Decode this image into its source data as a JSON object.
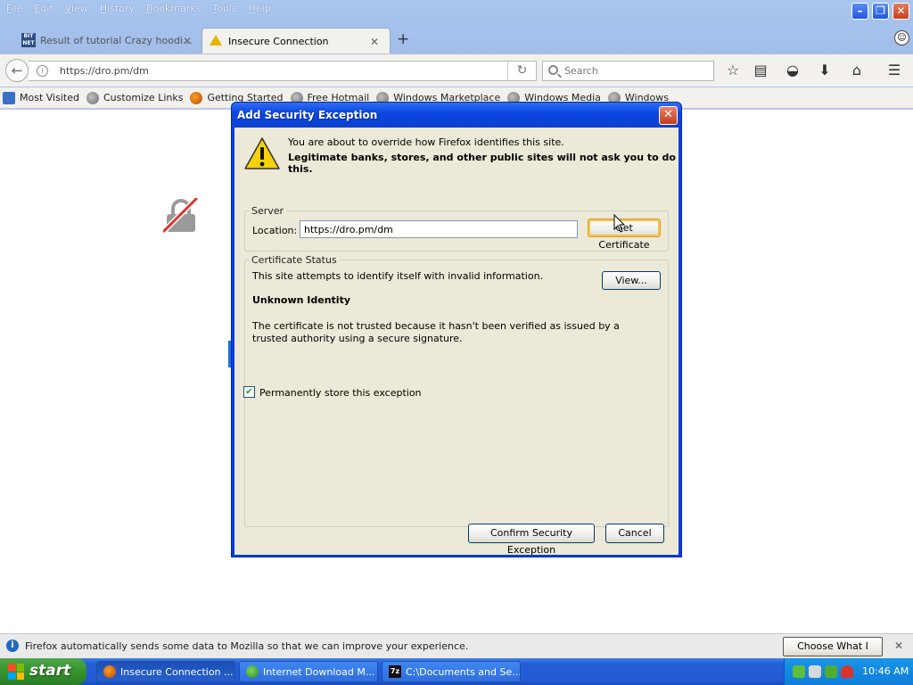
{
  "menubar": [
    "File",
    "Edit",
    "View",
    "History",
    "Bookmarks",
    "Tools",
    "Help"
  ],
  "tabs": [
    {
      "label": "Result of tutorial Crazy hoodi...",
      "favicon": "BIT NET"
    },
    {
      "label": "Insecure Connection",
      "active": true
    }
  ],
  "navbar": {
    "url": "https://dro.pm/dm",
    "search_placeholder": "Search"
  },
  "bookmarks": [
    "Most Visited",
    "Customize Links",
    "Getting Started",
    "Free Hotmail",
    "Windows Marketplace",
    "Windows Media",
    "Windows"
  ],
  "dialog": {
    "title": "Add Security Exception",
    "line1": "You are about to override how Firefox identifies this site.",
    "line2": "Legitimate banks, stores, and other public sites will not ask you to do this.",
    "server_caption": "Server",
    "location_label": "Location:",
    "location_value": "https://dro.pm/dm",
    "get_cert_label": "Get Certificate",
    "status_caption": "Certificate Status",
    "status_text": "This site attempts to identify itself with invalid information.",
    "view_label": "View...",
    "unknown_identity": "Unknown Identity",
    "cert_detail": "The certificate is not trusted because it hasn't been verified as issued by a trusted authority using a secure signature.",
    "permanent_label": "Permanently store this exception",
    "permanent_checked": true,
    "confirm_label": "Confirm Security Exception",
    "cancel_label": "Cancel"
  },
  "notification": {
    "text": "Firefox automatically sends some data to Mozilla so that we can improve your experience.",
    "button": "Choose What I Share"
  },
  "taskbar": {
    "start": "start",
    "tasks": [
      "Insecure Connection ...",
      "Internet Download M...",
      "C:\\Documents and Se..."
    ],
    "task3_badge": "7z",
    "clock": "10:46 AM"
  },
  "colors": {
    "titlebar": "#0a48e0",
    "dialog_face": "#ece9d8",
    "taskbar": "#245fd8",
    "start": "#37952f"
  }
}
